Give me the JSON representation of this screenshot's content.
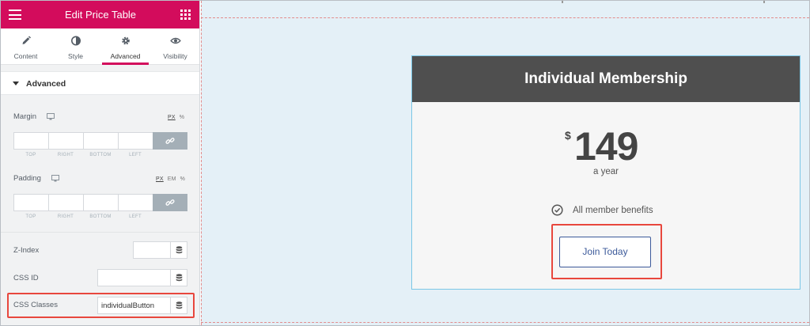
{
  "panel": {
    "title": "Edit Price Table",
    "tabs": [
      {
        "label": "Content",
        "icon": "pencil-icon",
        "active": false
      },
      {
        "label": "Style",
        "icon": "contrast-icon",
        "active": false
      },
      {
        "label": "Advanced",
        "icon": "gear-icon",
        "active": true
      },
      {
        "label": "Visibility",
        "icon": "eye-icon",
        "active": false
      }
    ],
    "section_title": "Advanced",
    "margin": {
      "label": "Margin",
      "units": [
        "PX",
        "%"
      ],
      "active_unit": "PX",
      "fields": [
        "TOP",
        "RIGHT",
        "BOTTOM",
        "LEFT"
      ]
    },
    "padding": {
      "label": "Padding",
      "units": [
        "PX",
        "EM",
        "%"
      ],
      "active_unit": "PX",
      "fields": [
        "TOP",
        "RIGHT",
        "BOTTOM",
        "LEFT"
      ]
    },
    "z_index": {
      "label": "Z-Index",
      "value": ""
    },
    "css_id": {
      "label": "CSS ID",
      "value": ""
    },
    "css_classes": {
      "label": "CSS Classes",
      "value": "individualButton"
    }
  },
  "pricing": {
    "title": "Individual Membership",
    "currency": "$",
    "price": "149",
    "period": "a year",
    "feature": "All member benefits",
    "button_label": "Join Today"
  },
  "colors": {
    "brand": "#d30c5c",
    "header_bg": "#4f4f4f",
    "highlight": "#e8473d",
    "button": "#3c5a9a",
    "canvas_bg": "#e4f0f7"
  }
}
